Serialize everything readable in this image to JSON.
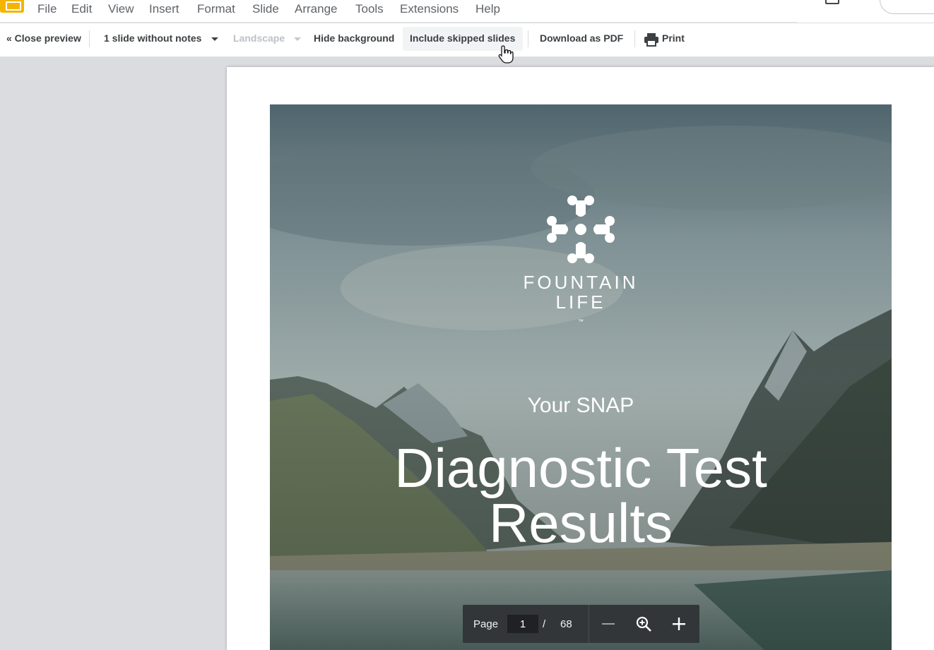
{
  "menu": {
    "items": [
      "File",
      "Edit",
      "View",
      "Insert",
      "Format",
      "Slide",
      "Arrange",
      "Tools",
      "Extensions",
      "Help"
    ]
  },
  "toolbar": {
    "close_preview": "« Close preview",
    "notes_option": "1 slide without notes",
    "orientation": "Landscape",
    "hide_background": "Hide background",
    "include_skipped": "Include skipped slides",
    "download_pdf": "Download as PDF",
    "print": "Print"
  },
  "slide": {
    "brand_line1": "FOUNTAIN",
    "brand_line2": "LIFE",
    "brand_tm": "™",
    "subtitle": "Your SNAP",
    "title_line1": "Diagnostic Test",
    "title_line2": "Results"
  },
  "pager": {
    "page_label": "Page",
    "current_page": "1",
    "separator": "/",
    "total_pages": "68"
  },
  "colors": {
    "toolbar_text": "#3c4043",
    "disabled_text": "#bdc1c6",
    "app_accent": "#f4b400",
    "pager_bg": "#323639"
  },
  "icons": [
    "slides-logo-icon",
    "present-icon",
    "print-icon",
    "hand-cursor-icon",
    "zoom-out-icon",
    "zoom-fit-icon",
    "zoom-in-icon",
    "fountain-life-logo-icon",
    "dropdown-caret-icon"
  ]
}
